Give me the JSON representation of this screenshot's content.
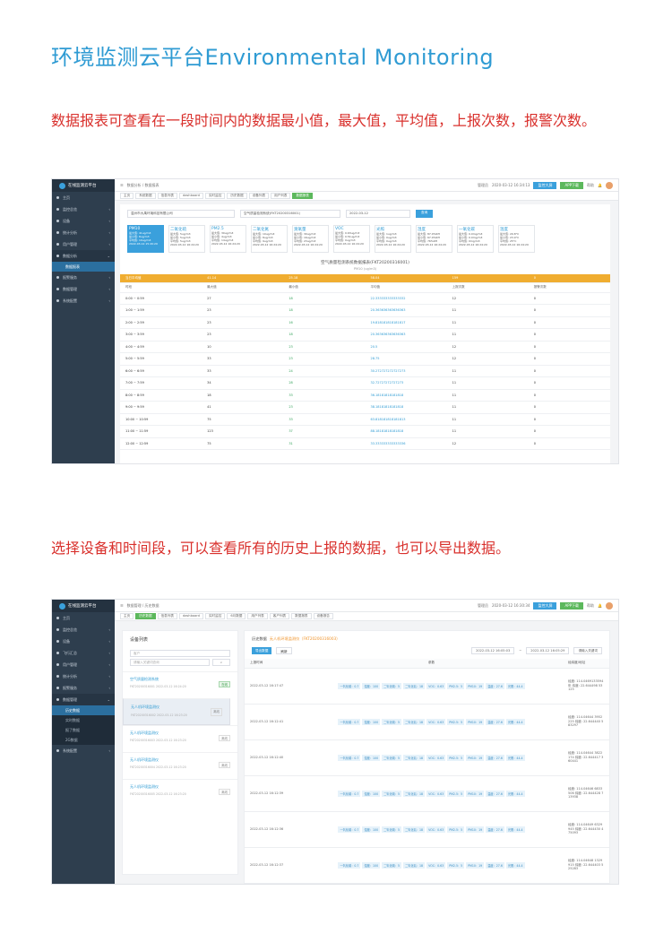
{
  "header": {
    "title": "环境监测云平台Environmental Monitoring",
    "caption1": "数据报表可查看在一段时间内的数据最小值，最大值，平均值，上报次数，报警次数。",
    "caption2": "选择设备和时间段，可以查看所有的历史上报的数据，也可以导出数据。"
  },
  "colors": {
    "accent": "#2f9bd3",
    "caption": "#d9302c",
    "sidebar": "#2e3e4e",
    "orange": "#f0ad30",
    "green": "#5cb85c"
  },
  "app": {
    "logo_text": "在线监测云平台",
    "user": "管理员",
    "time1": "2020-03-12 16:34:13",
    "time2": "2020-03-12 16:30:34",
    "btn_screen": "监控大屏",
    "btn_app": "APP下载",
    "btn_help": "帮助"
  },
  "shot1": {
    "sidebar": [
      {
        "label": "主页",
        "arrow": ""
      },
      {
        "label": "监控总览",
        "arrow": "‹"
      },
      {
        "label": "设备",
        "arrow": "‹"
      },
      {
        "label": "统计分析",
        "arrow": "‹"
      },
      {
        "label": "用户管理",
        "arrow": "‹"
      },
      {
        "label": "数据分析",
        "arrow": "⌄"
      }
    ],
    "sidebar_sub": "数据报表",
    "sidebar_after": [
      {
        "label": "报警服务",
        "arrow": "‹"
      },
      {
        "label": "数据管理",
        "arrow": "‹"
      },
      {
        "label": "系统配置",
        "arrow": "‹"
      }
    ],
    "breadcrumb": "数据分析 / 数据报表",
    "tabs": [
      "主页",
      "系统数据",
      "信息列表",
      "dashboard",
      "实时监控",
      "历史数据",
      "设备列表",
      "用户列表",
      "数据报表"
    ],
    "filters": {
      "company": "温州市大禹环境科技有限公司",
      "device": "空气质量检测系统(FKT20200316001)",
      "date": "2022-03-12",
      "query": "查询"
    },
    "cards": [
      {
        "name": "PM10",
        "l1": "最大值: 41ug/m3",
        "l2": "最小值: 8ug/m3",
        "l3": "平均值: 19ug/m3",
        "t": "2022-03-12 15:20:20"
      },
      {
        "name": "二氧化硫",
        "l1": "最大值: 5ug/m3",
        "l2": "最小值: 5ug/m3",
        "l3": "平均值: 5ug/m3",
        "t": "2022-03-12 16:24:20"
      },
      {
        "name": "PM2.5",
        "l1": "最大值: 30ug/m3",
        "l2": "最小值: 4ug/m3",
        "l3": "平均值: 14ug/m3",
        "t": "2022-03-12 16:24:20"
      },
      {
        "name": "二氧化氮",
        "l1": "最大值: 10ug/m3",
        "l2": "最小值: 8ug/m3",
        "l3": "平均值: 9ug/m3",
        "t": "2022-03-12 16:24:20"
      },
      {
        "name": "臭氧量",
        "l1": "最大值: 30ug/m3",
        "l2": "最小值: 16ug/m3",
        "l3": "平均值: 23ug/m3",
        "t": "2022-03-12 16:24:20"
      },
      {
        "name": "VOC",
        "l1": "最大值: 0.63ug/m3",
        "l2": "最小值: 0.51ug/m3",
        "l3": "平均值: 0ug/m3",
        "t": "2022-03-12 16:24:20"
      },
      {
        "name": "光照",
        "l1": "最大值: 1ug/m3",
        "l2": "最小值: 0ug/m3",
        "l3": "平均值: 0ug/m3",
        "t": "2022-03-12 16:24:20"
      },
      {
        "name": "湿度",
        "l1": "最大值: 87.0%RH",
        "l2": "最小值: 67.0%RH",
        "l3": "平均值: 76%RH",
        "t": "2022-03-12 16:24:20"
      },
      {
        "name": "一氧化碳",
        "l1": "最大值: 0.0mg/m3",
        "l2": "最小值: 0.0mg/m3",
        "l3": "平均值: 0mg/m3",
        "t": "2022-03-12 16:24:20"
      },
      {
        "name": "温度",
        "l1": "最大值: 29.8°C",
        "l2": "最小值: 23.9°C",
        "l3": "平均值: 25°C",
        "t": "2022-03-12 16:24:20"
      }
    ],
    "report_title": "空气质量检测系统数据报表(FKT20200316001)",
    "report_sub": "PM10 (ug/m3)",
    "summary": [
      "当日平均值",
      "41.14",
      "25.18",
      "58.04",
      "159",
      "0"
    ],
    "columns": [
      "时段",
      "最大值",
      "最小值",
      "平均值",
      "上报次数",
      "报警次数"
    ],
    "rows": [
      [
        "0:00 ~ 0:59",
        "27",
        "18",
        "22.333333333333332",
        "12",
        "0"
      ],
      [
        "1:00 ~ 1:59",
        "23",
        "18",
        "20.363636363636363",
        "11",
        "0"
      ],
      [
        "2:00 ~ 2:59",
        "23",
        "16",
        "19.818181818181817",
        "11",
        "0"
      ],
      [
        "3:00 ~ 3:59",
        "23",
        "18",
        "20.363636363636363",
        "11",
        "0"
      ],
      [
        "4:00 ~ 4:59",
        "10",
        "23",
        "20.5",
        "12",
        "0"
      ],
      [
        "5:00 ~ 5:59",
        "33",
        "23",
        "28.75",
        "12",
        "0"
      ],
      [
        "6:00 ~ 6:59",
        "33",
        "24",
        "30.272727272727273",
        "11",
        "0"
      ],
      [
        "7:00 ~ 7:59",
        "34",
        "28",
        "32.72727272727273",
        "11",
        "0"
      ],
      [
        "8:00 ~ 8:59",
        "18",
        "33",
        "36.18181818181818",
        "11",
        "0"
      ],
      [
        "9:00 ~ 9:59",
        "41",
        "23",
        "38.18181818181818",
        "11",
        "0"
      ],
      [
        "10:00 ~ 10:59",
        "75",
        "33",
        "63.818181818181813",
        "11",
        "0"
      ],
      [
        "11:00 ~ 11:59",
        "123",
        "37",
        "88.18181818181818",
        "11",
        "0"
      ],
      [
        "12:00 ~ 12:59",
        "75",
        "31",
        "33.333333333333336",
        "12",
        "0"
      ]
    ]
  },
  "shot2": {
    "sidebar": [
      {
        "label": "主页",
        "arrow": ""
      },
      {
        "label": "监控总览",
        "arrow": "‹"
      },
      {
        "label": "设备",
        "arrow": "‹"
      },
      {
        "label": "飞行汇总",
        "arrow": "‹"
      },
      {
        "label": "用户管理",
        "arrow": "‹"
      },
      {
        "label": "统计分析",
        "arrow": "‹"
      },
      {
        "label": "报警服务",
        "arrow": "‹"
      },
      {
        "label": "数据管理",
        "arrow": "⌄"
      }
    ],
    "sidebar_subs": [
      "历史数据",
      "实时数据",
      "报了数据",
      "2G数据"
    ],
    "sidebar_after": [
      {
        "label": "系统配置",
        "arrow": "‹"
      }
    ],
    "breadcrumb": "数据管理 / 历史数据",
    "tabs": [
      "主页",
      "历史数据",
      "信息列表",
      "dashboard",
      "实时监控",
      "6月数据",
      "用户列表",
      "客户列表",
      "数据报表",
      "设备报告"
    ],
    "list_title": "设备列表",
    "list_input": "客户",
    "list_search": "请输入关键词查询",
    "devices": [
      {
        "name": "空气质量检测系统",
        "meta": "FKT20200316001  2022-03-12 16:24:20",
        "badge": "在线",
        "green": true,
        "selected": false
      },
      {
        "name": "无人机环境监测仪",
        "meta": "FKT20200316002  2022-03-12 16:23:20",
        "badge": "离线",
        "green": false,
        "selected": true
      },
      {
        "name": "无人机环境监测仪",
        "meta": "FKT20200316003  2022-03-12 16:23:20",
        "badge": "离线",
        "green": false,
        "selected": false
      },
      {
        "name": "无人机环境监测仪",
        "meta": "FKT20200316004  2022-03-12 16:23:20",
        "badge": "离线",
        "green": false,
        "selected": false
      },
      {
        "name": "无人机环境监测仪",
        "meta": "FKT20200316005  2022-03-12 16:23:20",
        "badge": "离线",
        "green": false,
        "selected": false
      }
    ],
    "panel_label": "历史数据",
    "panel_device": "无人机环境监测仪（FKT20200316003）",
    "btn_export": "导出数据",
    "btn_refresh": "刷新",
    "date_from": "2022-03-12 16:05:03",
    "date_to": "2022-03-12 16:05:29",
    "search_placeholder": "请输入关键词",
    "columns": [
      "上报时间",
      "参数",
      "经纬度/地址"
    ],
    "params": [
      "一氧化碳：0.7",
      "湿度：100",
      "二氧化硫：5",
      "二氧化氮：18",
      "VOC：0.63",
      "PM2.5：5",
      "PM10：19",
      "温度：27.6",
      "光照：44.4"
    ],
    "rows": [
      {
        "time": "2022-03-12 16:17:47",
        "loc": "经度: 114.0469133594年 纬度: 22.644498 53125"
      },
      {
        "time": "2022-03-12 16:12:41",
        "loc": "经度: 114.04644 3952225 纬度: 22.644440 583297"
      },
      {
        "time": "2022-03-12 16:12:40",
        "loc": "经度: 114.04644 3822174 纬度: 22.644417 360441"
      },
      {
        "time": "2022-03-12 16:12:39",
        "loc": "经度: 114.04646 6833506 纬度: 22.644428 713938"
      },
      {
        "time": "2022-03-12 16:12:36",
        "loc": "经度: 114.04649 6329945 纬度: 22.644430 475093"
      },
      {
        "time": "2022-03-12 16:12:37",
        "loc": "经度: 114.04648 1329915 纬度: 22.644403 525283"
      }
    ]
  }
}
